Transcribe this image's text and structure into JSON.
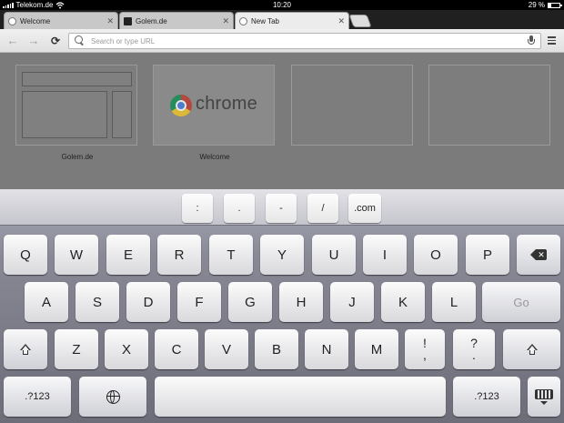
{
  "status_bar": {
    "carrier": "Telekom.de",
    "time": "10:20",
    "battery_percent": "29 %",
    "battery_level": 0.29
  },
  "tabs": [
    {
      "title": "Welcome",
      "favicon": "globe-icon",
      "active": false
    },
    {
      "title": "Golem.de",
      "favicon": "golem-favicon",
      "active": false
    },
    {
      "title": "New Tab",
      "favicon": "globe-icon",
      "active": true
    }
  ],
  "toolbar": {
    "omnibox_placeholder": "Search or type URL",
    "omnibox_value": ""
  },
  "most_visited": [
    {
      "label": "Golem.de"
    },
    {
      "label": "Welcome",
      "logo_text": "chrome"
    },
    {
      "label": ""
    },
    {
      "label": ""
    }
  ],
  "keyboard": {
    "accessory_keys": [
      ":",
      ".",
      "-",
      "/",
      ".com"
    ],
    "row1": [
      "Q",
      "W",
      "E",
      "R",
      "T",
      "Y",
      "U",
      "I",
      "O",
      "P"
    ],
    "row2": [
      "A",
      "S",
      "D",
      "F",
      "G",
      "H",
      "J",
      "K",
      "L"
    ],
    "go_label": "Go",
    "row3": [
      "Z",
      "X",
      "C",
      "V",
      "B",
      "N",
      "M"
    ],
    "row3_punct": [
      {
        "top": "!",
        "bottom": ","
      },
      {
        "top": "?",
        "bottom": "."
      }
    ],
    "numbers_label": ".?123"
  }
}
